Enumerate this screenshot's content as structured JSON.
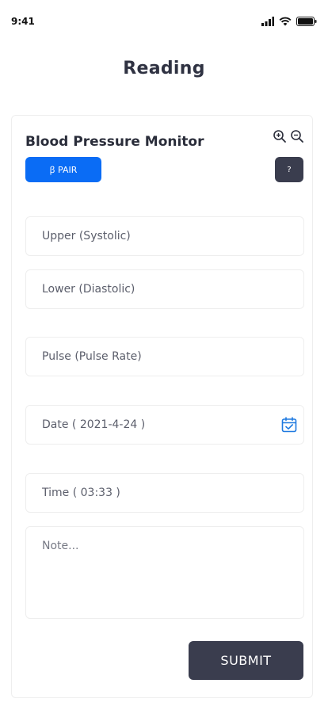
{
  "status_bar": {
    "time": "9:41"
  },
  "page": {
    "title": "Reading"
  },
  "device": {
    "name": "Blood Pressure Monitor",
    "pair_label": "ꞵ PAIR",
    "help_label": "?"
  },
  "form": {
    "systolic_placeholder": "Upper (Systolic)",
    "diastolic_placeholder": "Lower (Diastolic)",
    "pulse_placeholder": "Pulse (Pulse Rate)",
    "date_label": "Date ( 2021-4-24 )",
    "time_label": "Time ( 03:33 )",
    "note_placeholder": "Note...",
    "submit_label": "SUBMIT"
  },
  "icons": {
    "zoom_in": "zoom-in-icon",
    "zoom_out": "zoom-out-icon",
    "calendar": "calendar-check-icon",
    "signal": "signal-icon",
    "wifi": "wifi-icon",
    "battery": "battery-icon"
  },
  "colors": {
    "primary_blue": "#0a6cf5",
    "dark_button": "#3a3d4e",
    "calendar_icon": "#1f7ae0"
  }
}
